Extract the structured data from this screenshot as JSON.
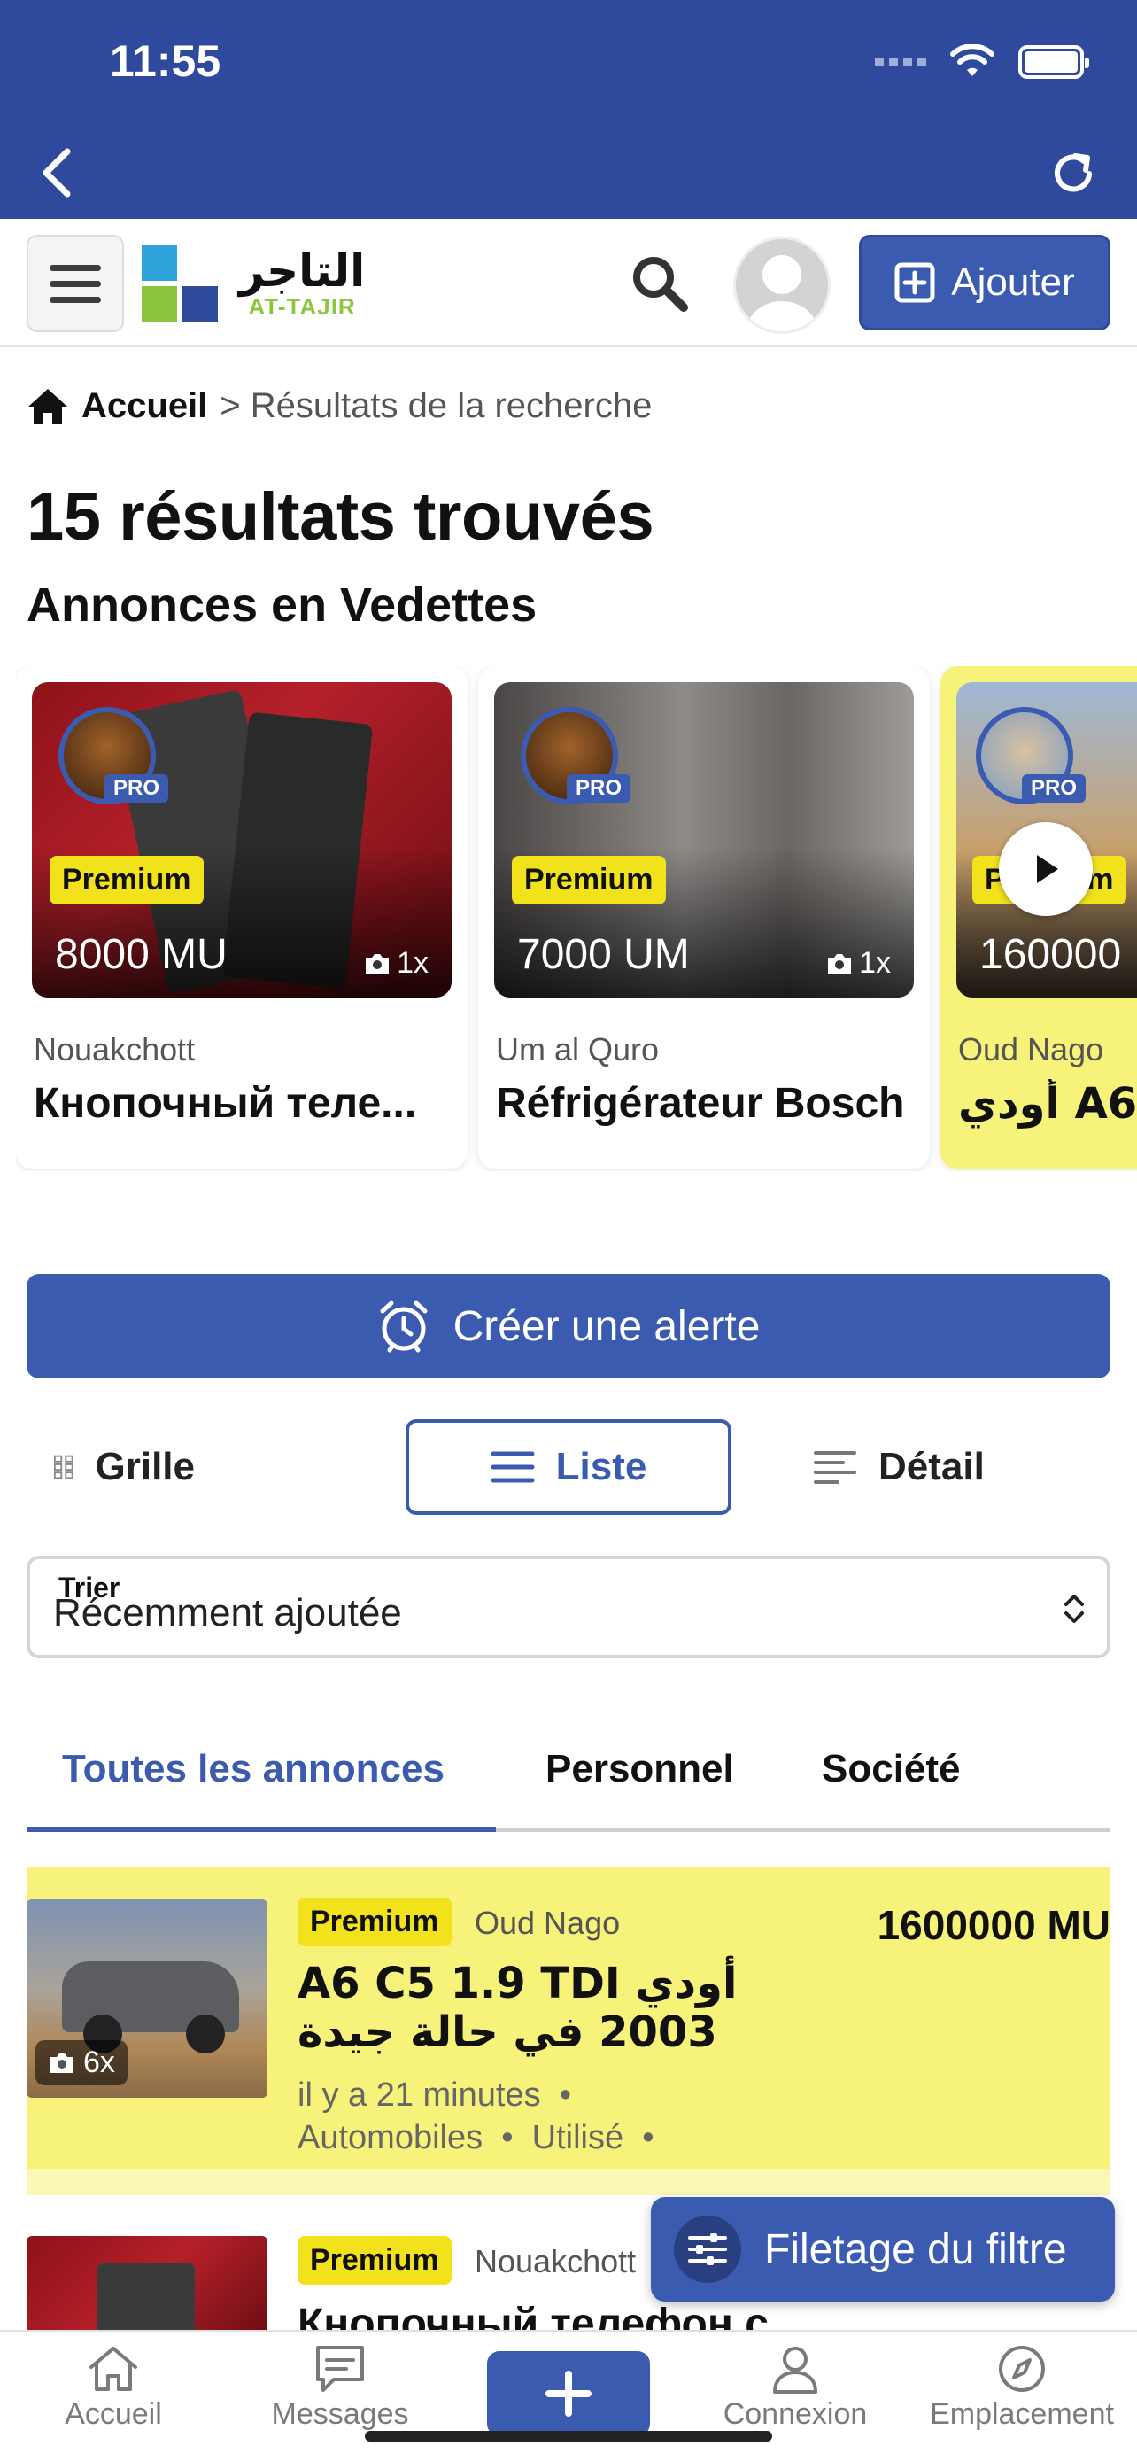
{
  "status_bar": {
    "time": "11:55"
  },
  "header": {
    "logo_arabic": "التاجر",
    "logo_latin": "AT-TAJIR",
    "add_label": "Ajouter"
  },
  "breadcrumb": {
    "home": "Accueil",
    "current": "> Résultats de la recherche"
  },
  "page_title": "15 résultats trouvés",
  "featured": {
    "title": "Annonces en Vedettes",
    "cards": [
      {
        "badge": "Premium",
        "pro": "PRO",
        "price": "8000 MU",
        "photos": "1x",
        "city": "Nouakchott",
        "title": "Кнопочный теле..."
      },
      {
        "badge": "Premium",
        "pro": "PRO",
        "price": "7000 UM",
        "photos": "1x",
        "city": "Um al Quro",
        "title": "Réfrigérateur Bosch"
      },
      {
        "badge": "Premium",
        "pro": "PRO",
        "price": "160000",
        "city": "Oud Nago",
        "title": "أودي A6"
      }
    ]
  },
  "alert_button": "Créer une alerte",
  "view_modes": {
    "grid": "Grille",
    "list": "Liste",
    "detail": "Détail",
    "selected": "list"
  },
  "sort": {
    "label": "Trier",
    "value": "Récemment ajoutée"
  },
  "tabs": {
    "all": "Toutes les annonces",
    "personal": "Personnel",
    "company": "Société",
    "selected": "all"
  },
  "listings": [
    {
      "badge": "Premium",
      "city": "Oud Nago",
      "price": "1600000 MU",
      "title": "أودي A6 C5 1.9 TDI 2003 في حالة جيدة",
      "time": "il y a 21 minutes",
      "category": "Automobiles",
      "condition": "Utilisé",
      "photos": "6x"
    },
    {
      "badge": "Premium",
      "city": "Nouakchott",
      "title": "Кнопочный телефон с"
    }
  ],
  "filter_button": "Filetage du filtre",
  "bottom_nav": {
    "home": "Accueil",
    "messages": "Messages",
    "login": "Connexion",
    "location": "Emplacement"
  },
  "colors": {
    "primary": "#3b5bb0",
    "topbar": "#2f4a9c",
    "premium_highlight": "#f7f27a",
    "premium_badge": "#f2e21c"
  }
}
